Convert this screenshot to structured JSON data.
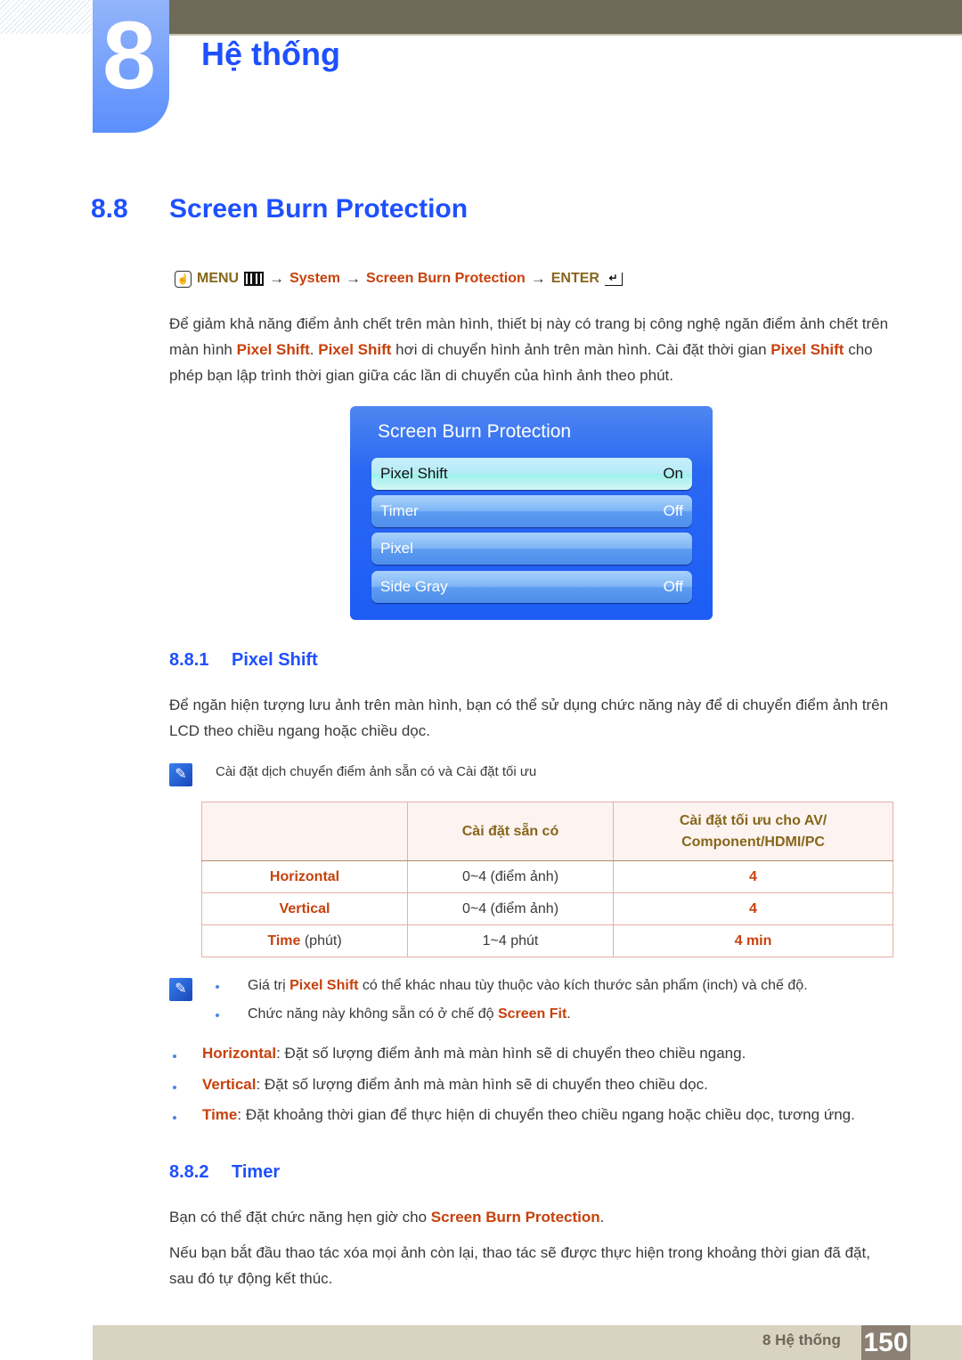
{
  "chapter": {
    "number": "8",
    "title": "Hệ thống"
  },
  "section": {
    "number": "8.8",
    "title": "Screen Burn Protection"
  },
  "menu_path": {
    "hand_icon": "remote-hand-icon",
    "menu_label": "MENU",
    "menu_icon": "menu-grid-icon",
    "arrow": "→",
    "steps": [
      "System",
      "Screen Burn Protection"
    ],
    "enter_label": "ENTER",
    "enter_icon": "enter-icon"
  },
  "intro": {
    "part1": "Để giảm khả năng điểm ảnh chết trên màn hình, thiết bị này có trang bị công nghệ ngăn điểm ảnh chết trên màn hình ",
    "hl1": "Pixel Shift",
    "part2": ". ",
    "hl2": "Pixel Shift",
    "part3": " hơi di chuyển hình ảnh trên màn hình. Cài đặt thời gian ",
    "hl3": "Pixel Shift",
    "part4": " cho phép bạn lập trình thời gian giữa các lần di chuyển của hình ảnh theo phút."
  },
  "osd": {
    "title": "Screen Burn Protection",
    "items": [
      {
        "label": "Pixel Shift",
        "value": "On",
        "active": true
      },
      {
        "label": "Timer",
        "value": "Off",
        "active": false
      },
      {
        "label": "Pixel",
        "value": "",
        "active": false
      },
      {
        "label": "Side Gray",
        "value": "Off",
        "active": false
      }
    ]
  },
  "pixel_shift": {
    "number": "8.8.1",
    "title": "Pixel Shift",
    "description": "Để ngăn hiện tượng lưu ảnh trên màn hình, bạn có thể sử dụng chức năng này để di chuyển điểm ảnh trên LCD theo chiều ngang hoặc chiều dọc.",
    "note_icon": "note-pencil-icon",
    "note": "Cài đặt dịch chuyển điểm ảnh sẵn có và Cài đặt tối ưu",
    "table": {
      "headers": [
        "",
        "Cài đặt sẵn có",
        "Cài đặt tối ưu cho AV/\nComponent/HDMI/PC"
      ],
      "header_line1": "Cài đặt tối ưu cho AV/",
      "header_line2": "Component/HDMI/PC",
      "rows": [
        {
          "name": "Horizontal",
          "unit": "",
          "available": "0~4 (điểm ảnh)",
          "optimal": "4"
        },
        {
          "name": "Vertical",
          "unit": "",
          "available": "0~4 (điểm ảnh)",
          "optimal": "4"
        },
        {
          "name": "Time",
          "unit": " (phút)",
          "available": "1~4 phút",
          "optimal": "4 min"
        }
      ]
    },
    "notes": [
      {
        "pre": "Giá trị ",
        "hl": "Pixel Shift",
        "post": " có thể khác nhau tùy thuộc vào kích thước sản phẩm (inch) và chế độ."
      },
      {
        "pre": "Chức năng này không sẵn có ở chế độ ",
        "hl": "Screen Fit",
        "post": "."
      }
    ],
    "bullets": [
      {
        "term": "Horizontal",
        "text": ": Đặt số lượng điểm ảnh mà màn hình sẽ di chuyển theo chiều ngang."
      },
      {
        "term": "Vertical",
        "text": ": Đặt số lượng điểm ảnh mà màn hình sẽ di chuyển theo chiều dọc."
      },
      {
        "term": "Time",
        "text": ": Đặt khoảng thời gian để thực hiện di chuyển theo chiều ngang hoặc chiều dọc, tương ứng."
      }
    ]
  },
  "timer": {
    "number": "8.8.2",
    "title": "Timer",
    "line1_pre": "Bạn có thể đặt chức năng hẹn giờ cho ",
    "line1_hl": "Screen Burn Protection",
    "line1_post": ".",
    "line2": "Nếu bạn bắt đầu thao tác xóa mọi ảnh còn lại, thao tác sẽ được thực hiện trong khoảng thời gian đã đặt, sau đó tự động kết thúc."
  },
  "footer": {
    "label": "8 Hệ thống",
    "page": "150"
  },
  "colors": {
    "heading_blue": "#1e50ff",
    "highlight": "#c7410c",
    "menu_gold": "#86661a",
    "osd_blue": "#1d5df5"
  }
}
